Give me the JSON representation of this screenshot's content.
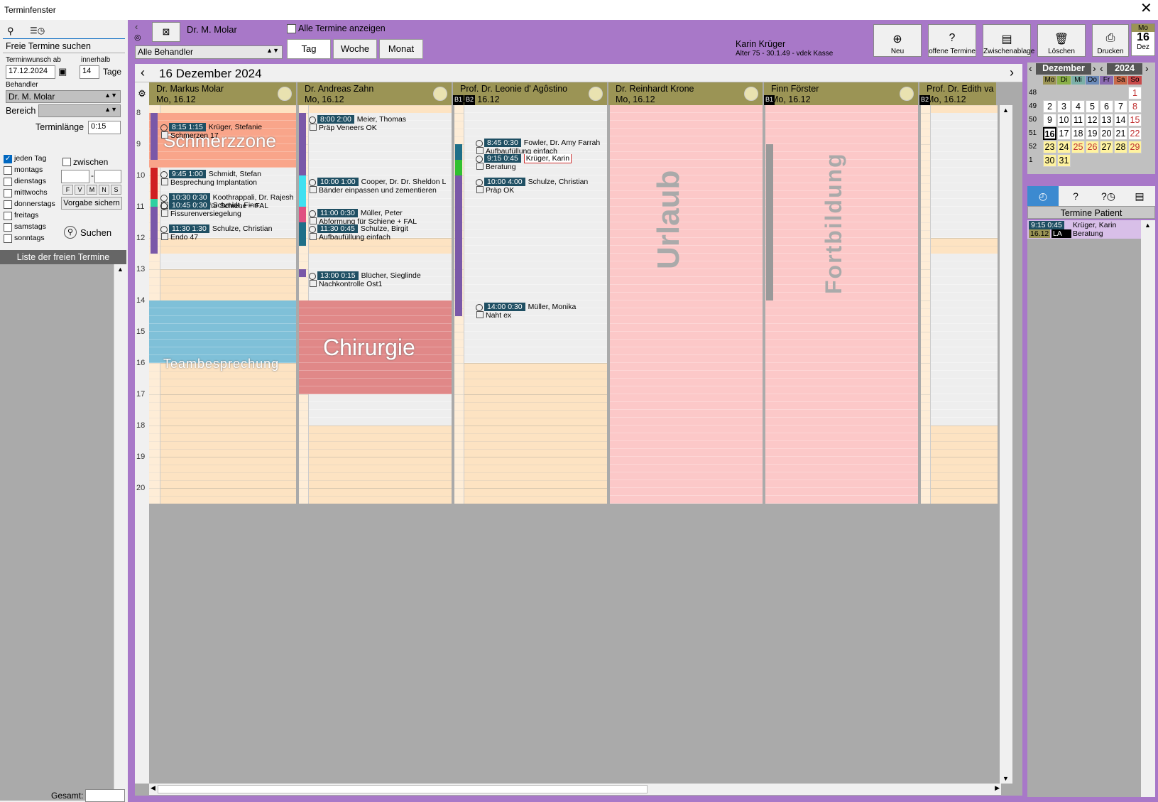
{
  "window": {
    "title": "Terminfenster",
    "close": "✕"
  },
  "left": {
    "freie_title": "Freie Termine suchen",
    "wunsch_lbl": "Terminwunsch ab",
    "innerhalb_lbl": "innerhalb",
    "wunsch_val": "17.12.2024",
    "tage_val": "14",
    "tage_lbl": "Tage",
    "behandler_lbl": "Behandler",
    "behandler_val": "Dr. M. Molar",
    "bereich_lbl": "Bereich",
    "terminlaenge_lbl": "Terminlänge",
    "terminlaenge_val": "0:15",
    "days": [
      "jeden Tag",
      "montags",
      "dienstags",
      "mittwochs",
      "donnerstags",
      "freitags",
      "samstags",
      "sonntags"
    ],
    "zwischen": "zwischen",
    "fvmns": [
      "F",
      "V",
      "M",
      "N",
      "S"
    ],
    "vorgabe": "Vorgabe sichern",
    "suchen": "Suchen",
    "liste": "Liste der freien Termine",
    "gesamt": "Gesamt:"
  },
  "top": {
    "doctor": "Dr. M. Molar",
    "alle_termine": "Alle Termine anzeigen",
    "alle_behandler": "Alle Behandler",
    "tabs": [
      "Tag",
      "Woche",
      "Monat"
    ],
    "patient_name": "Karin Krüger",
    "patient_info": "Alter 75 - 30.1.49 - vdek Kasse",
    "buttons": [
      {
        "label": "Neu",
        "icon": "⊕"
      },
      {
        "label": "offene Termine",
        "icon": "?"
      },
      {
        "label": "Zwischenablage",
        "icon": "▤"
      },
      {
        "label": "Löschen",
        "icon": "🗑"
      },
      {
        "label": "Drucken",
        "icon": "⎙"
      }
    ],
    "date_badge": {
      "wd": "Mo",
      "day": "16",
      "mon": "Dez"
    }
  },
  "cal": {
    "title": "16 Dezember 2024",
    "hours": [
      "8",
      "9",
      "10",
      "11",
      "12",
      "13",
      "14",
      "15",
      "16",
      "17",
      "18",
      "19",
      "20"
    ],
    "columns": [
      {
        "name": "Dr. Markus Molar",
        "date": "Mo,  16.12"
      },
      {
        "name": "Dr. Andreas Zahn",
        "date": "Mo,  16.12"
      },
      {
        "name": "Prof. Dr. Leonie d' Agôstino",
        "date": "Mo,  16.12"
      },
      {
        "name": "Dr. Reinhardt Krone",
        "date": "Mo,  16.12"
      },
      {
        "name": "Finn Förster",
        "date": "Mo,  16.12"
      },
      {
        "name": "Prof. Dr. Edith va",
        "date": "Mo,  16.12"
      }
    ],
    "badges": [
      "B1",
      "B2",
      "B1",
      "B2"
    ],
    "blocks": {
      "schmerz": "Schmerzzone",
      "team": "Teambesprechung",
      "chir": "Chirurgie",
      "urlaub": "Urlaub",
      "fort": "Fortbildung"
    },
    "appts": [
      {
        "t": "8:15  1:15",
        "n": "Krüger, Stefanie",
        "s": "Schmerzen 17"
      },
      {
        "t": "9:45  1:00",
        "n": "Schmidt, Stefan",
        "s": "Besprechung Implantation"
      },
      {
        "t": "10:30  0:30",
        "n": "Koothrappali, Dr. Rajesh Ra",
        "s": "Abformung für Schiene + FAL"
      },
      {
        "t": "10:45  0:30",
        "n": "Schmidt, Finn",
        "s": "Fissurenversiegelung"
      },
      {
        "t": "11:30  1:30",
        "n": "Schulze, Christian",
        "s": "Endo 47"
      },
      {
        "t": "8:00  2:00",
        "n": "Meier, Thomas",
        "s": "Präp  Veneers OK"
      },
      {
        "t": "10:00  1:00",
        "n": "Cooper, Dr. Dr. Sheldon L",
        "s": "Bänder einpassen und zementieren"
      },
      {
        "t": "11:00  0:30",
        "n": "Müller, Peter",
        "s": "Abformung für Schiene + FAL"
      },
      {
        "t": "11:30  0:45",
        "n": "Schulze, Birgit",
        "s": "Aufbaufüllung einfach"
      },
      {
        "t": "13:00  0:15",
        "n": "Blücher, Sieglinde",
        "s": "Nachkontrolle Ost1"
      },
      {
        "t": "8:45  0:30",
        "n": "Fowler, Dr. Amy Farrah",
        "s": "Aufbaufüllung einfach"
      },
      {
        "t": "9:15  0:45",
        "n": "Krüger, Karin",
        "s": "Beratung"
      },
      {
        "t": "10:00  4:00",
        "n": "Schulze, Christian",
        "s": "Präp OK"
      },
      {
        "t": "14:00  0:30",
        "n": "Müller, Monika",
        "s": "Naht ex"
      }
    ]
  },
  "right": {
    "month": "Dezember",
    "year": "2024",
    "wd": [
      "Mo",
      "Di",
      "Mi",
      "Do",
      "Fr",
      "Sa",
      "So"
    ],
    "weeks": [
      {
        "kw": "48",
        "days": [
          "",
          "",
          "",
          "",
          "",
          "",
          "1"
        ]
      },
      {
        "kw": "49",
        "days": [
          "2",
          "3",
          "4",
          "5",
          "6",
          "7",
          "8"
        ]
      },
      {
        "kw": "50",
        "days": [
          "9",
          "10",
          "11",
          "12",
          "13",
          "14",
          "15"
        ]
      },
      {
        "kw": "51",
        "days": [
          "16",
          "17",
          "18",
          "19",
          "20",
          "21",
          "22"
        ]
      },
      {
        "kw": "52",
        "days": [
          "23",
          "24",
          "25",
          "26",
          "27",
          "28",
          "29"
        ]
      },
      {
        "kw": "1",
        "days": [
          "30",
          "31",
          "",
          "",
          "",
          "",
          ""
        ]
      }
    ],
    "termine_patient": "Termine Patient",
    "pt_appt": {
      "t": "9:15  0:45",
      "n": "Krüger, Karin",
      "d": "16.12",
      "c": "LA",
      "s": "Beratung"
    }
  },
  "colors": {
    "purple": "#a878c8",
    "header": "#9b9455",
    "orange": "#fde3c2",
    "pink": "#fcc8c8",
    "team": "#7fc0d8",
    "chir": "#e08888",
    "salmon": "#f9a58a"
  }
}
